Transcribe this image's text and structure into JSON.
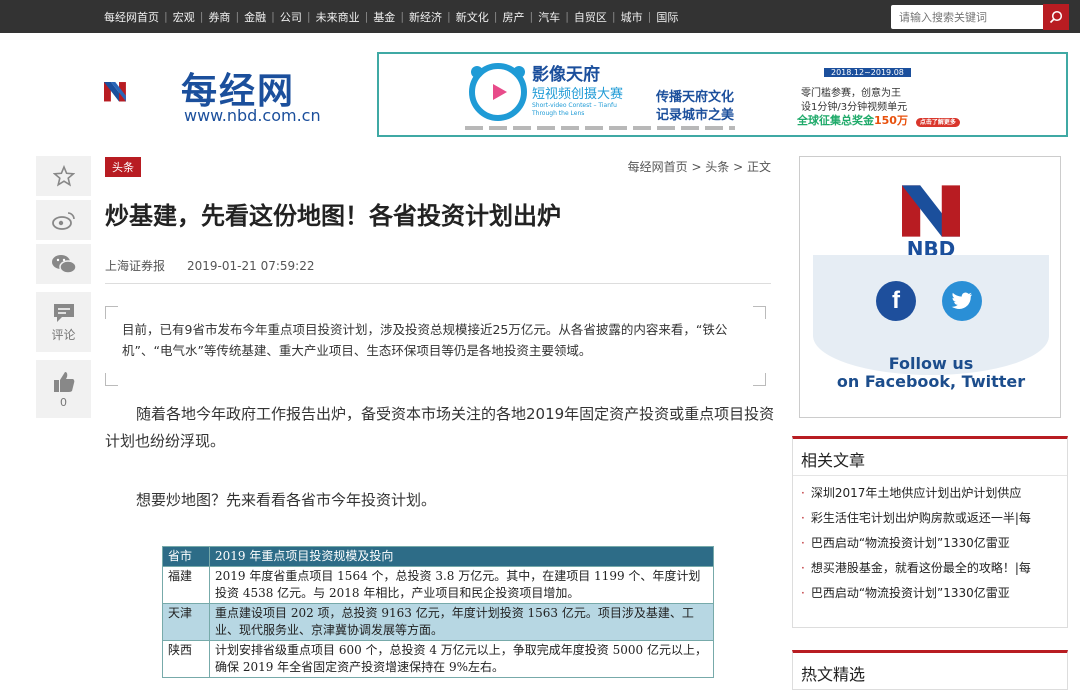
{
  "nav": {
    "items": [
      "每经网首页",
      "宏观",
      "券商",
      "金融",
      "公司",
      "未来商业",
      "基金",
      "新经济",
      "新文化",
      "房产",
      "汽车",
      "自贸区",
      "城市",
      "国际"
    ],
    "search_placeholder": "请输入搜索关键词"
  },
  "logo": {
    "name": "每经网",
    "url": "www.nbd.com.cn"
  },
  "banner": {
    "title": "影像天府",
    "subtitle": "短视频创摄大赛",
    "subtitle_en": "Short-video Contest – Tianfu Through the Lens",
    "slogan_line1": "传播天府文化",
    "slogan_line2": "记录城市之美",
    "date_range": "2018.12~2019.08",
    "line1": "零门槛参赛，创意为王",
    "line2": "设1分钟/3分钟视频单元",
    "prize_label": "全球征集总奖金",
    "prize_value": "150万",
    "cta": "点击了解更多"
  },
  "side": {
    "comment_label": "评论",
    "like_count": "0"
  },
  "article": {
    "tag": "头条",
    "breadcrumb": "每经网首页 > 头条 > 正文",
    "title": "炒基建，先看这份地图！各省投资计划出炉",
    "source": "上海证券报",
    "date": "2019-01-21 07:59:22",
    "summary": "目前，已有9省市发布今年重点项目投资计划，涉及投资总规模接近25万亿元。从各省披露的内容来看，“铁公机”、“电气水”等传统基建、重大产业项目、生态环保项目等仍是各地投资主要领域。",
    "para1": "随着各地今年政府工作报告出炉，备受资本市场关注的各地2019年固定资产投资或重点项目投资计划也纷纷浮现。",
    "para2": "想要炒地图？先来看看各省市今年投资计划。",
    "table": {
      "headers": [
        "省市",
        "2019 年重点项目投资规模及投向"
      ],
      "rows": [
        [
          "福建",
          "2019 年度省重点项目 1564 个，总投资 3.8 万亿元。其中，在建项目 1199 个、年度计划投资 4538 亿元。与 2018 年相比，产业项目和民企投资项目增加。"
        ],
        [
          "天津",
          "重点建设项目 202 项，总投资 9163 亿元，年度计划投资 1563 亿元。项目涉及基建、工业、现代服务业、京津冀协调发展等方面。"
        ],
        [
          "陕西",
          "计划安排省级重点项目 600 个，总投资 4 万亿元以上，争取完成年度投资 5000 亿元以上，确保 2019 年全省固定资产投资增速保持在 9%左右。"
        ]
      ]
    }
  },
  "sidebar": {
    "nbd_text": "NBD",
    "follow_line1": "Follow us",
    "follow_line2": "on Facebook, Twitter",
    "related_title": "相关文章",
    "related": [
      "深圳2017年土地供应计划出炉计划供应",
      "彩生活住宅计划出炉购房款或返还一半|每",
      "巴西启动“物流投资计划”1330亿雷亚",
      "想买港股基金，就看这份最全的攻略！|每",
      "巴西启动“物流投资计划”1330亿雷亚"
    ],
    "hot_title": "热文精选"
  },
  "colors": {
    "brand_red": "#b81c22",
    "brand_blue": "#1b4f9c",
    "nav_bg": "#333333",
    "table_head": "#2d6c87"
  }
}
